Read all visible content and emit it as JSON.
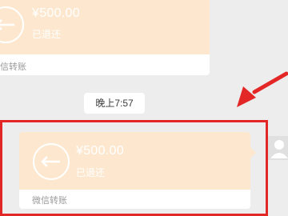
{
  "messages": [
    {
      "amount": "¥500.00",
      "status": "已退还",
      "footer": "信转账"
    },
    {
      "amount": "¥500.00",
      "status": "已退还",
      "footer": "微信转账"
    }
  ],
  "time": "晚上7:57",
  "colors": {
    "card": "#fde8cf",
    "background": "#ededed",
    "highlight": "#e32626",
    "arrow": "#e32626"
  },
  "icons": {
    "return": "back-arrow-icon",
    "avatar": "default-avatar-icon"
  }
}
